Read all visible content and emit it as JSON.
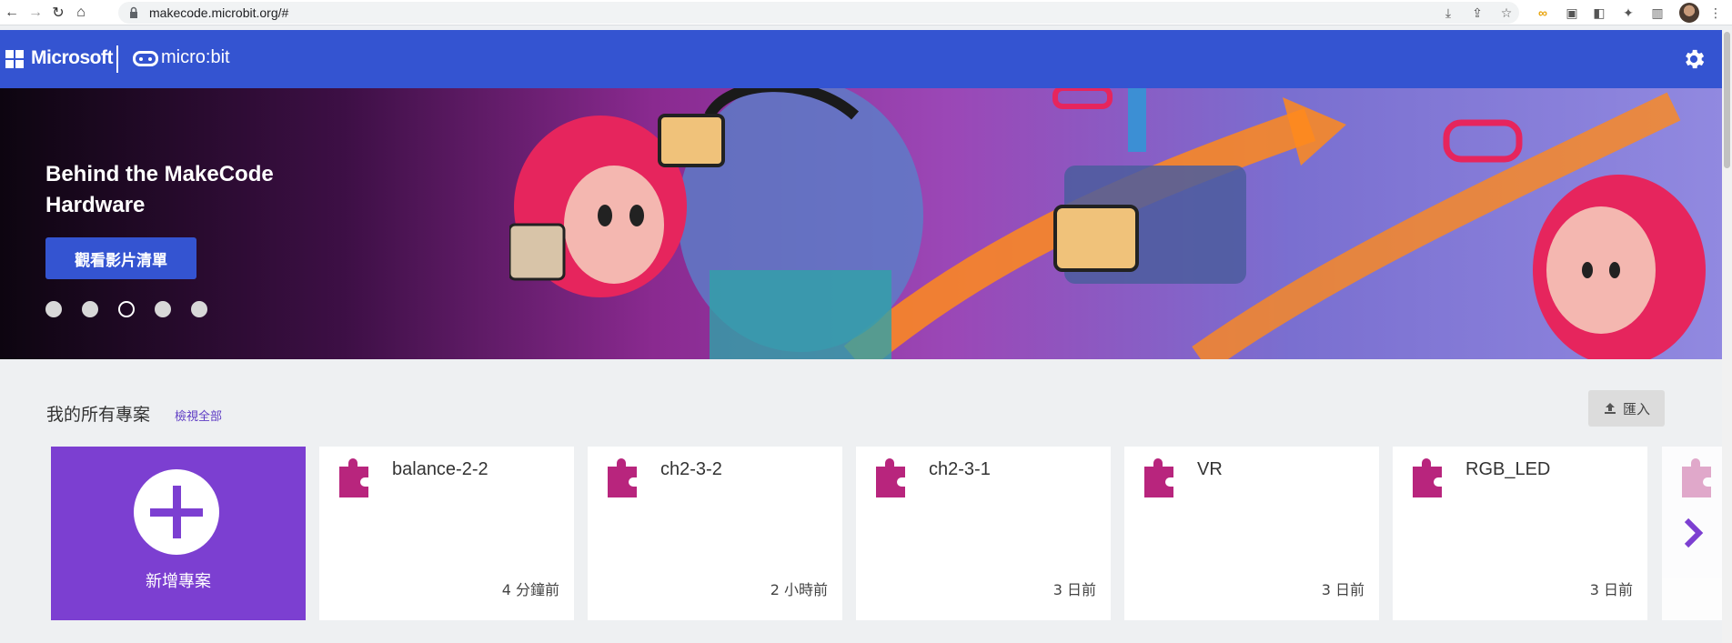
{
  "browser": {
    "url": "makecode.microbit.org/#"
  },
  "header": {
    "microsoft_label": "Microsoft",
    "product_label": "micro:bit"
  },
  "hero": {
    "title": "Behind the MakeCode Hardware",
    "button_label": "觀看影片清單",
    "slide_count": 5,
    "active_slide": 3
  },
  "projects": {
    "section_title": "我的所有專案",
    "view_all_label": "檢視全部",
    "import_label": "匯入",
    "new_project_label": "新增專案",
    "items": [
      {
        "name": "balance-2-2",
        "time": "4 分鐘前"
      },
      {
        "name": "ch2-3-2",
        "time": "2 小時前"
      },
      {
        "name": "ch2-3-1",
        "time": "3 日前"
      },
      {
        "name": "VR",
        "time": "3 日前"
      },
      {
        "name": "RGB_LED",
        "time": "3 日前"
      }
    ]
  },
  "colors": {
    "header_bg": "#3454d1",
    "new_card_bg": "#7c3fd1",
    "puzzle": "#b8257d",
    "link": "#5e3cc4"
  }
}
